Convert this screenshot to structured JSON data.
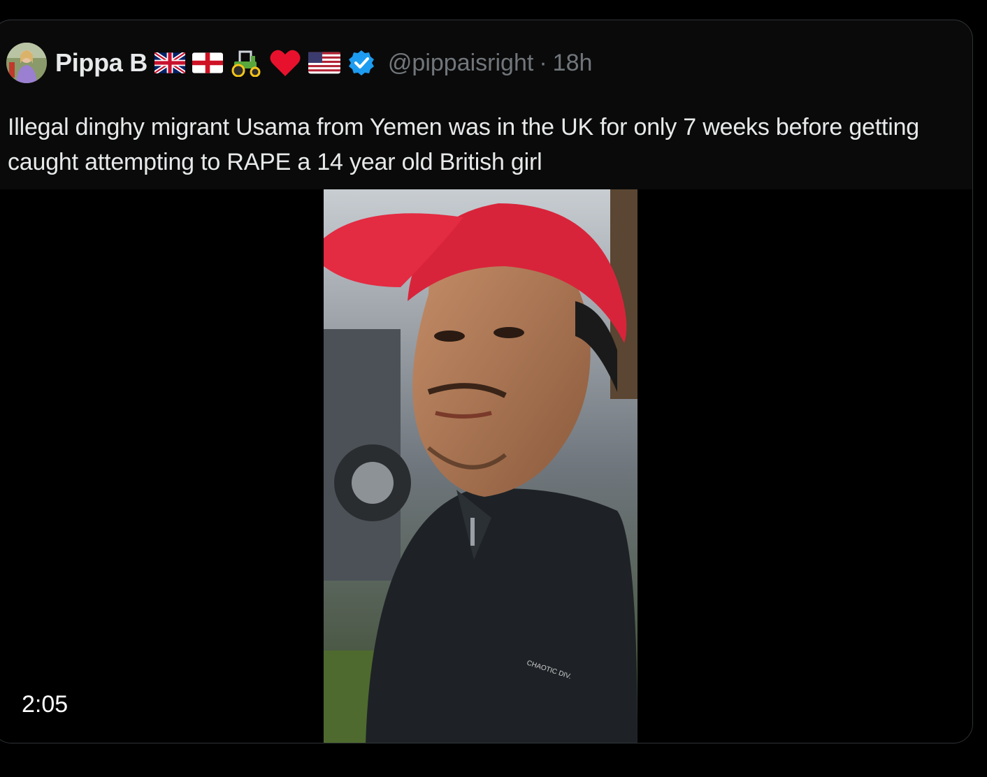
{
  "tweet": {
    "author": {
      "display_name": "Pippa B",
      "badges": [
        "uk-flag-icon",
        "england-flag-icon",
        "tractor-icon",
        "red-heart-icon",
        "us-flag-icon"
      ],
      "verified": true,
      "handle": "@pippaisright"
    },
    "separator": "·",
    "time": "18h",
    "text": "Illegal dinghy migrant Usama from Yemen was in the UK for only 7 weeks before getting caught attempting to RAPE a 14 year old British girl",
    "media": {
      "type": "video",
      "duration": "2:05"
    }
  },
  "colors": {
    "background": "#000000",
    "card_background": "#0a0a0a",
    "card_border": "#2f3336",
    "text_primary": "#e7e9ea",
    "text_secondary": "#71767b",
    "verified_blue": "#1d9bf0",
    "heart_red": "#f91880"
  }
}
